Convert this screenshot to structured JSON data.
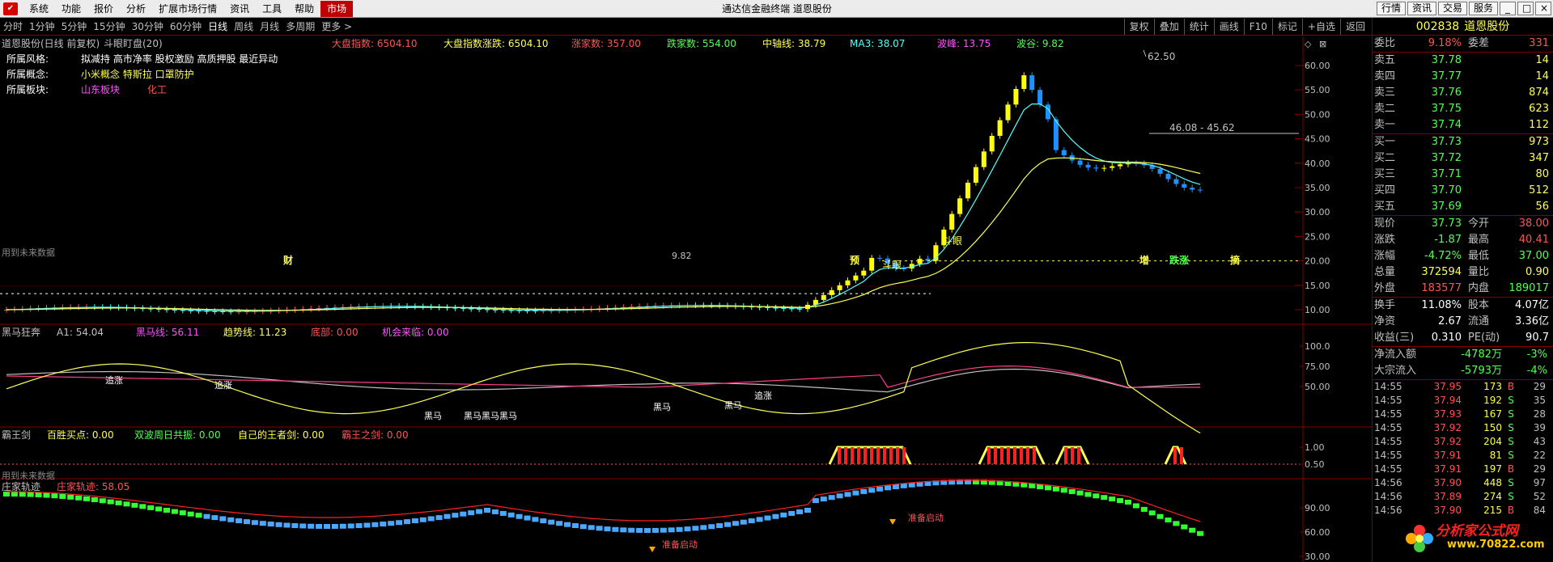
{
  "menubar": {
    "items": [
      "系统",
      "功能",
      "报价",
      "分析",
      "扩展市场行情",
      "资讯",
      "工具",
      "帮助"
    ],
    "active": "市场",
    "title": "通达信金融终端 道恩股份",
    "right_buttons": [
      "行情",
      "资讯",
      "交易",
      "服务"
    ],
    "window_controls": [
      "_",
      "□",
      "×"
    ]
  },
  "periodbar": {
    "periods": [
      "分时",
      "1分钟",
      "5分钟",
      "15分钟",
      "30分钟",
      "60分钟",
      "日线",
      "周线",
      "月线",
      "多周期",
      "更多 >"
    ],
    "active": "日线",
    "tools": [
      "复权",
      "叠加",
      "统计",
      "画线",
      "F10",
      "标记",
      "+自选",
      "返回"
    ]
  },
  "main_panel": {
    "header_name": "道恩股份(日线 前复权)",
    "indicator_name": "斗眼盯盘(20)",
    "indicators": [
      {
        "label": "大盘指数:",
        "value": "6504.10",
        "color": "#ff5454"
      },
      {
        "label": "大盘指数涨跌:",
        "value": "6504.10",
        "color": "#ffff54"
      },
      {
        "label": "涨家数:",
        "value": "357.00",
        "color": "#ff5454"
      },
      {
        "label": "跌家数:",
        "value": "554.00",
        "color": "#54ff54"
      },
      {
        "label": "中轴线:",
        "value": "38.79",
        "color": "#ffff54"
      },
      {
        "label": "MA3:",
        "value": "38.07",
        "color": "#54ffff"
      },
      {
        "label": "波峰:",
        "value": "13.75",
        "color": "#ff54ff"
      },
      {
        "label": "波谷:",
        "value": "9.82",
        "color": "#54ff54"
      }
    ],
    "info": [
      {
        "label": "所属风格:",
        "value": "拟减持 高市净率 股权激励 高质押股 最近异动",
        "color": "#ffffff"
      },
      {
        "label": "所属概念:",
        "value": "小米概念 特斯拉 口罩防护",
        "color": "#ffff54"
      },
      {
        "label": "所属板块:",
        "value": "山东板块",
        "value2": "化工",
        "color": "#ff54ff",
        "color2": "#ff5454"
      }
    ],
    "y_axis": [
      "60.00",
      "55.00",
      "50.00",
      "45.00",
      "40.00",
      "35.00",
      "30.00",
      "25.00",
      "20.00",
      "15.00",
      "10.00"
    ],
    "annotations": {
      "high": "62.50",
      "range": "46.08 - 45.62",
      "low": "9.82",
      "douyan1": "斗眼",
      "douyan2": "斗眼",
      "future": "用到未来数据"
    },
    "events": [
      "财",
      "预",
      "增",
      "跌涨",
      "摘"
    ]
  },
  "panel2": {
    "name": "黑马狂奔",
    "indicators": [
      {
        "label": "A1:",
        "value": "54.04",
        "color": "#c0c0c0"
      },
      {
        "label": "黑马线:",
        "value": "56.11",
        "color": "#ff54ff"
      },
      {
        "label": "趋势线:",
        "value": "11.23",
        "color": "#ffff54"
      },
      {
        "label": "底部:",
        "value": "0.00",
        "color": "#ff5454"
      },
      {
        "label": "机会来临:",
        "value": "0.00",
        "color": "#ff54ff"
      }
    ],
    "y_axis": [
      "100.0",
      "75.00",
      "50.00"
    ],
    "labels": [
      "追涨",
      "追涨",
      "黑马",
      "黑马黑马黑马",
      "黑马",
      "黑马",
      "追涨"
    ]
  },
  "panel3": {
    "name": "霸王剑",
    "indicators": [
      {
        "label": "百胜买点:",
        "value": "0.00",
        "color": "#ffff54"
      },
      {
        "label": "双波周日共振:",
        "value": "0.00",
        "color": "#54ff54"
      },
      {
        "label": "自己的王者剑:",
        "value": "0.00",
        "color": "#ffff54"
      },
      {
        "label": "霸王之剑:",
        "value": "0.00",
        "color": "#ff5454"
      }
    ],
    "y_axis": [
      "1.00",
      "0.50"
    ],
    "future": "用到未来数据"
  },
  "panel4": {
    "name": "庄家轨迹",
    "indicators": [
      {
        "label": "庄家轨迹:",
        "value": "58.05",
        "color": "#ff5454"
      }
    ],
    "y_axis": [
      "90.00",
      "60.00",
      "30.00"
    ],
    "labels": [
      "准备启动",
      "准备启动"
    ]
  },
  "quote": {
    "code": "002838",
    "name": "道恩股份",
    "weibi": {
      "label": "委比",
      "value": "9.18%",
      "label2": "委差",
      "value2": "331"
    },
    "sell": [
      {
        "label": "卖五",
        "price": "37.78",
        "vol": "14"
      },
      {
        "label": "卖四",
        "price": "37.77",
        "vol": "14"
      },
      {
        "label": "卖三",
        "price": "37.76",
        "vol": "874"
      },
      {
        "label": "卖二",
        "price": "37.75",
        "vol": "623"
      },
      {
        "label": "卖一",
        "price": "37.74",
        "vol": "112"
      }
    ],
    "buy": [
      {
        "label": "买一",
        "price": "37.73",
        "vol": "973"
      },
      {
        "label": "买二",
        "price": "37.72",
        "vol": "347"
      },
      {
        "label": "买三",
        "price": "37.71",
        "vol": "80"
      },
      {
        "label": "买四",
        "price": "37.70",
        "vol": "512"
      },
      {
        "label": "买五",
        "price": "37.69",
        "vol": "56"
      }
    ],
    "stats": [
      {
        "l": "现价",
        "v": "37.73",
        "vc": "dn",
        "l2": "今开",
        "v2": "38.00",
        "v2c": "up"
      },
      {
        "l": "涨跌",
        "v": "-1.87",
        "vc": "dn",
        "l2": "最高",
        "v2": "40.41",
        "v2c": "up"
      },
      {
        "l": "涨幅",
        "v": "-4.72%",
        "vc": "dn",
        "l2": "最低",
        "v2": "37.00",
        "v2c": "dn"
      },
      {
        "l": "总量",
        "v": "372594",
        "vc": "yl",
        "l2": "量比",
        "v2": "0.90",
        "v2c": "yl"
      },
      {
        "l": "外盘",
        "v": "183577",
        "vc": "up",
        "l2": "内盘",
        "v2": "189017",
        "v2c": "dn"
      }
    ],
    "stats2": [
      {
        "l": "换手",
        "v": "11.08%",
        "vc": "wh",
        "l2": "股本",
        "v2": "4.07亿",
        "v2c": "wh"
      },
      {
        "l": "净资",
        "v": "2.67",
        "vc": "wh",
        "l2": "流通",
        "v2": "3.36亿",
        "v2c": "wh"
      },
      {
        "l": "收益(三)",
        "v": "0.310",
        "vc": "wh",
        "l2": "PE(动)",
        "v2": "90.7",
        "v2c": "wh"
      }
    ],
    "flows": [
      {
        "l": "净流入额",
        "v": "-4782万",
        "v2": "-3%"
      },
      {
        "l": "大宗流入",
        "v": "-5793万",
        "v2": "-4%"
      }
    ],
    "ticks": [
      {
        "t": "14:55",
        "p": "37.95",
        "v": "173",
        "bs": "B",
        "n": "29"
      },
      {
        "t": "14:55",
        "p": "37.94",
        "v": "192",
        "bs": "S",
        "n": "35"
      },
      {
        "t": "14:55",
        "p": "37.93",
        "v": "167",
        "bs": "S",
        "n": "28"
      },
      {
        "t": "14:55",
        "p": "37.92",
        "v": "150",
        "bs": "S",
        "n": "39"
      },
      {
        "t": "14:55",
        "p": "37.92",
        "v": "204",
        "bs": "S",
        "n": "43"
      },
      {
        "t": "14:55",
        "p": "37.91",
        "v": "81",
        "bs": "S",
        "n": "22"
      },
      {
        "t": "14:55",
        "p": "37.91",
        "v": "197",
        "bs": "B",
        "n": "29"
      },
      {
        "t": "14:56",
        "p": "37.90",
        "v": "448",
        "bs": "S",
        "n": "97"
      },
      {
        "t": "14:56",
        "p": "37.89",
        "v": "274",
        "bs": "S",
        "n": "52"
      },
      {
        "t": "14:56",
        "p": "37.90",
        "v": "215",
        "bs": "B",
        "n": "84"
      }
    ]
  },
  "watermark": {
    "text1": "分析家公式网",
    "text2": "www.70822.com"
  }
}
